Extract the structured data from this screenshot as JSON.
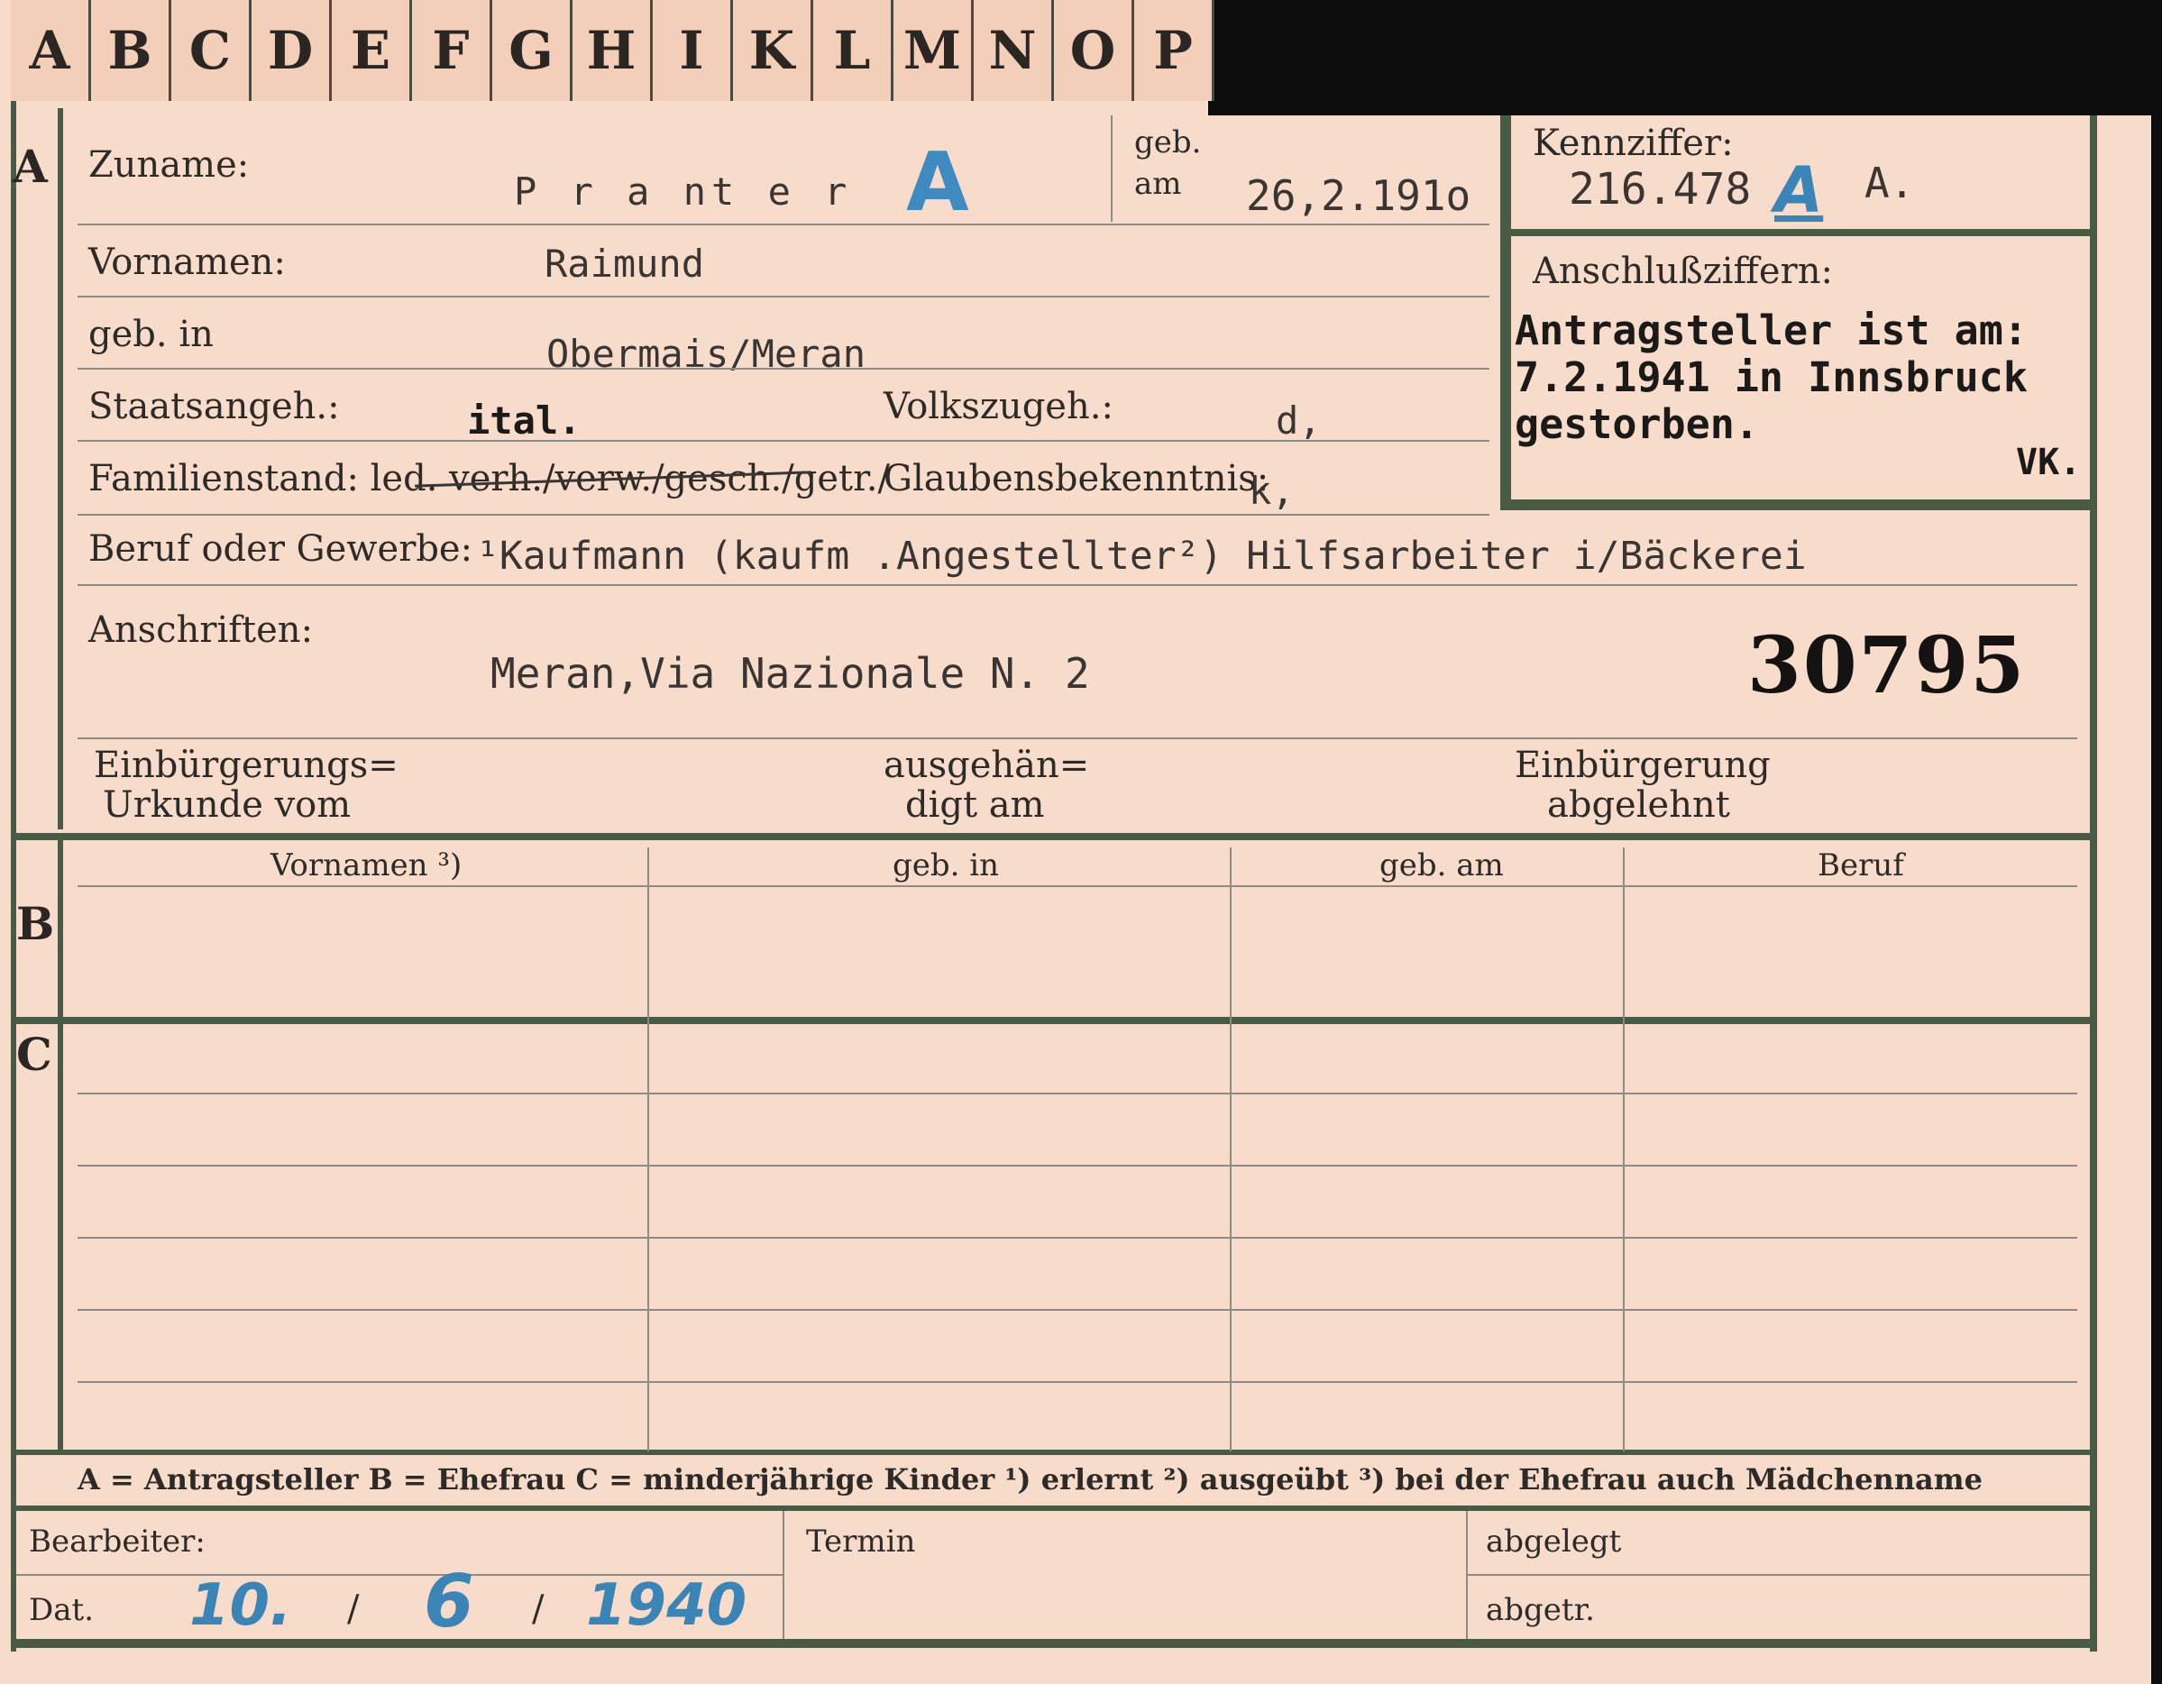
{
  "tabs": [
    "A",
    "B",
    "C",
    "D",
    "E",
    "F",
    "G",
    "H",
    "I",
    "K",
    "L",
    "M",
    "N",
    "O",
    "P"
  ],
  "sections": {
    "a": "A",
    "b": "B",
    "c": "C"
  },
  "labels": {
    "zuname": "Zuname:",
    "geb": "geb.",
    "am": "am",
    "vornamen": "Vornamen:",
    "geb_in": "geb. in",
    "staatsangeh": "Staatsangeh.:",
    "volkszugeh": "Volkszugeh.:",
    "familienstand": "Familienstand: led. verh./verw./gesch./getr./",
    "glaubensbekenntnis": "Glaubensbekenntnis:",
    "beruf": "Beruf oder Gewerbe:",
    "anschriften": "Anschriften:",
    "einb_urkunde_1": "Einbürgerungs=",
    "einb_urkunde_2": "Urkunde vom",
    "ausgeh_1": "ausgehän=",
    "ausgeh_2": "digt am",
    "einb_abgel_1": "Einbürgerung",
    "einb_abgel_2": "abgelehnt",
    "kennziffer": "Kennziffer:",
    "anschlussziffern": "Anschlußziffern:"
  },
  "values": {
    "zuname": "P r a nt   e r",
    "geb_am": "26,2.191o",
    "vornamen": "Raimund",
    "geb_in": "Obermais/Meran",
    "staatsangeh": "ital.",
    "volkszugeh": "d,",
    "glaubensbekenntnis": "k,",
    "beruf": "¹Kaufmann (kaufm .Angestellter²) Hilfsarbeiter i/Bäckerei",
    "anschrift": "Meran,Via Nazionale N. 2",
    "card_number": "30795",
    "kennziffer": "216.478",
    "kennziffer_mark": "A",
    "kennziffer_suffix": "A.",
    "hand_mark": "A"
  },
  "anschluss_note": {
    "line1": "Antragsteller ist am:",
    "line2": "7.2.1941 in Innsbruck",
    "line3": "gestorben.",
    "initials": "VK."
  },
  "table_headers": [
    "Vornamen ³)",
    "geb. in",
    "geb. am",
    "Beruf"
  ],
  "legend": "A = Antragsteller   B = Ehefrau   C = minderjährige Kinder   ¹) erlernt   ²) ausgeübt   ³) bei der Ehefrau auch Mädchenname",
  "footer": {
    "bearbeiter": "Bearbeiter:",
    "dat": "Dat.",
    "termin": "Termin",
    "abgelegt": "abgelegt",
    "abgetr": "abgetr.",
    "date_day": "10.",
    "date_month": "6",
    "date_year": "1940",
    "date_sep1": "/",
    "date_sep2": "/"
  }
}
